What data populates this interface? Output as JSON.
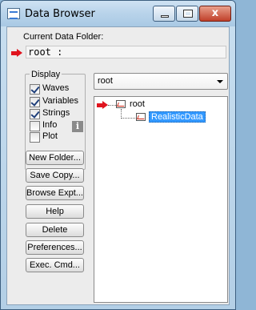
{
  "window": {
    "title": "Data Browser",
    "close_glyph": "x"
  },
  "current_folder": {
    "label": "Current Data Folder:",
    "path": "root :"
  },
  "display": {
    "legend": "Display",
    "options": [
      {
        "label": "Waves",
        "checked": true
      },
      {
        "label": "Variables",
        "checked": true
      },
      {
        "label": "Strings",
        "checked": true
      },
      {
        "label": "Info",
        "checked": false
      },
      {
        "label": "Plot",
        "checked": false
      }
    ],
    "info_glyph": "i"
  },
  "buttons": {
    "new_folder": "New Folder...",
    "save_copy": "Save Copy...",
    "browse_expt": "Browse Expt...",
    "help": "Help",
    "delete": "Delete",
    "preferences": "Preferences...",
    "exec_cmd": "Exec. Cmd..."
  },
  "folder_select": {
    "value": "root"
  },
  "tree": {
    "root_label": "root",
    "child_label": "RealisticData"
  },
  "icons": {
    "current-folder-marker": "red-arrow-icon",
    "folder": "folder-icon",
    "app": "data-browser-icon"
  }
}
